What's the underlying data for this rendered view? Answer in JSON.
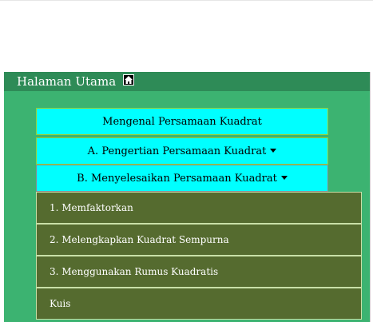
{
  "header": {
    "title": "Halaman Utama",
    "home_icon": "home-icon"
  },
  "menu": {
    "intro_label": "Mengenal Persamaan Kuadrat",
    "section_a_label": "A. Pengertian Persamaan Kuadrat",
    "section_b_label": "B. Menyelesaikan Persamaan Kuadrat"
  },
  "dropdown": {
    "items": [
      {
        "label": "1. Memfaktorkan"
      },
      {
        "label": "2. Melengkapkan Kuadrat Sempurna"
      },
      {
        "label": "3. Menggunakan Rumus Kuadratis"
      },
      {
        "label": "Kuis"
      }
    ]
  },
  "colors": {
    "panel": "#3cb371",
    "header": "#2e8b57",
    "button": "#00ffff",
    "dropdown": "#556b2f"
  }
}
